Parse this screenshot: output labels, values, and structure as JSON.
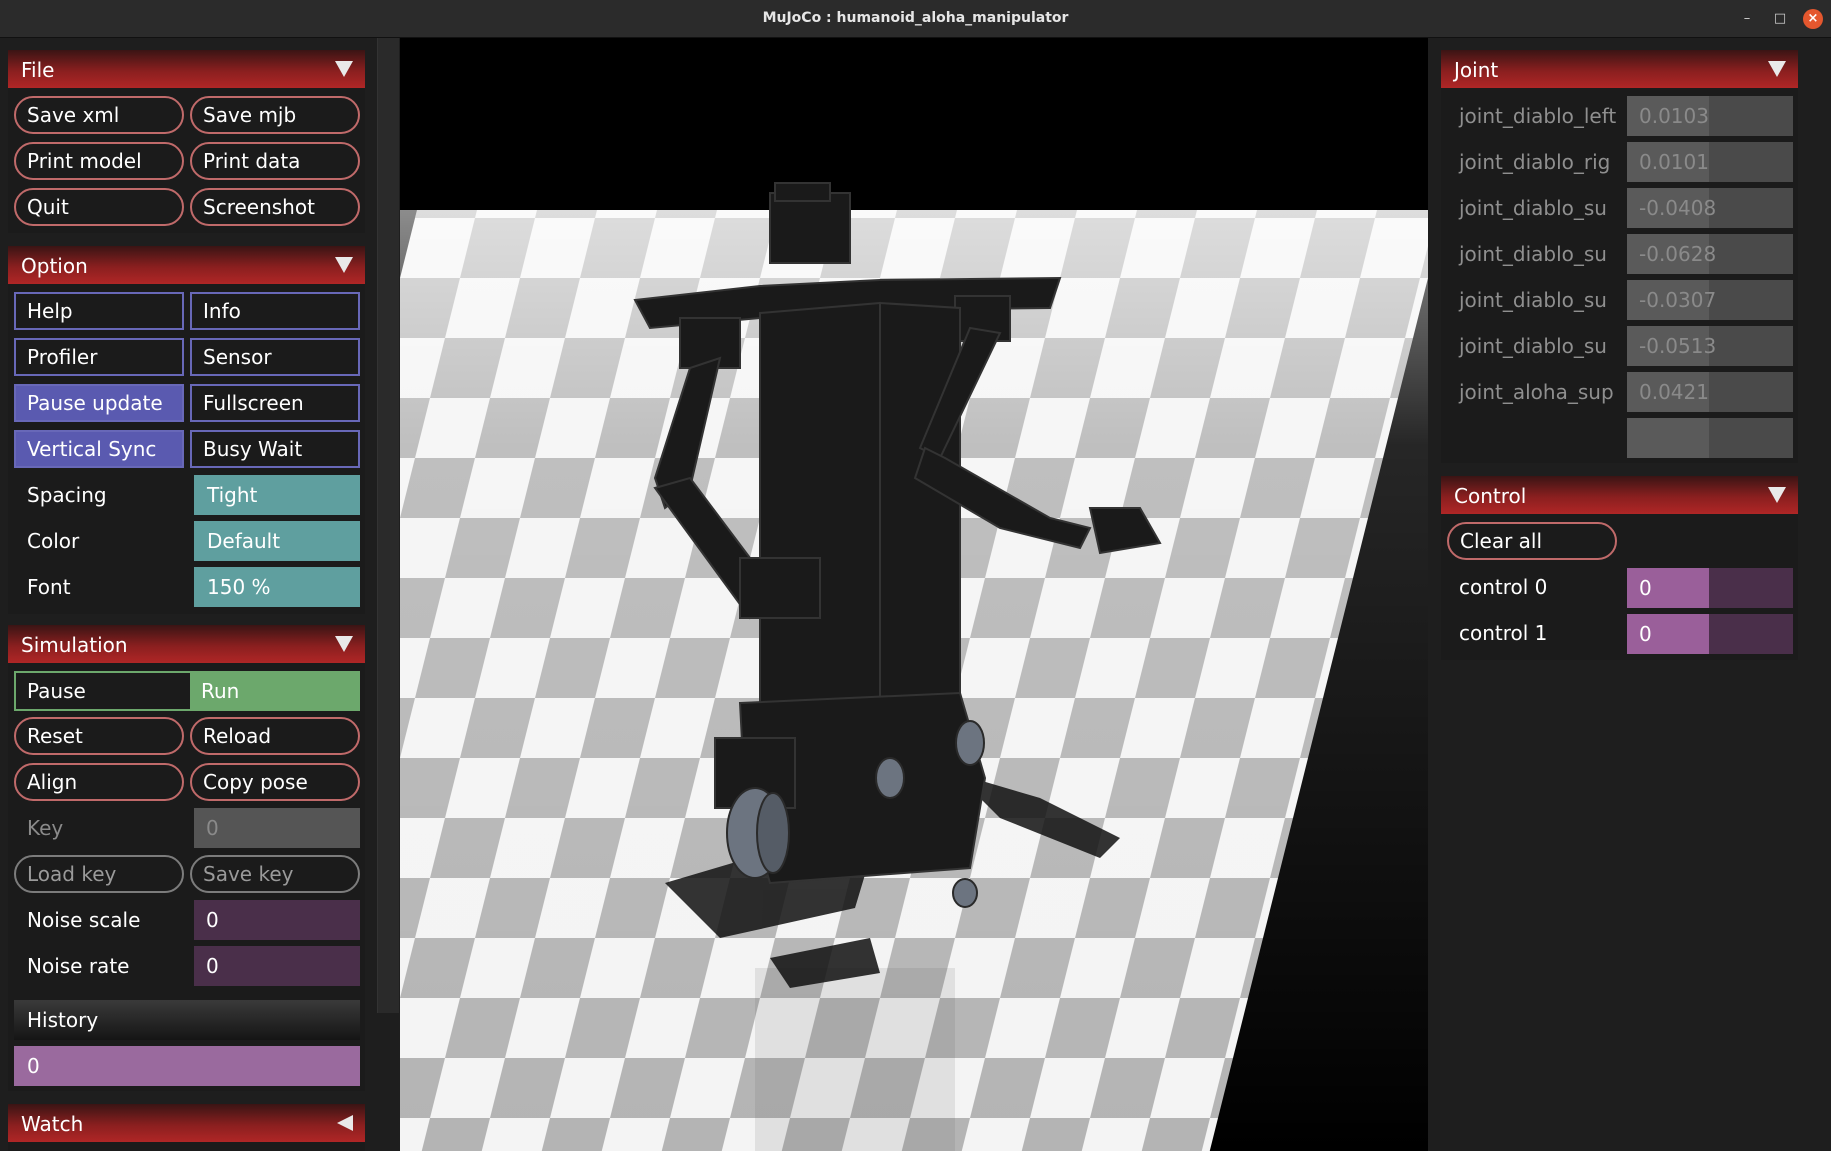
{
  "window": {
    "title": "MuJoCo : humanoid_aloha_manipulator"
  },
  "file": {
    "header": "File",
    "buttons": [
      "Save xml",
      "Save mjb",
      "Print model",
      "Print data",
      "Quit",
      "Screenshot"
    ]
  },
  "option": {
    "header": "Option",
    "toggles": [
      {
        "label": "Help",
        "on": false
      },
      {
        "label": "Info",
        "on": false
      },
      {
        "label": "Profiler",
        "on": false
      },
      {
        "label": "Sensor",
        "on": false
      },
      {
        "label": "Pause update",
        "on": true
      },
      {
        "label": "Fullscreen",
        "on": false
      },
      {
        "label": "Vertical Sync",
        "on": true
      },
      {
        "label": "Busy Wait",
        "on": false
      }
    ],
    "spacing_label": "Spacing",
    "spacing_value": "Tight",
    "color_label": "Color",
    "color_value": "Default",
    "font_label": "Font",
    "font_value": "150 %"
  },
  "simulation": {
    "header": "Simulation",
    "pause": "Pause",
    "run": "Run",
    "reset": "Reset",
    "reload": "Reload",
    "align": "Align",
    "copy_pose": "Copy pose",
    "key_label": "Key",
    "key_value": "0",
    "load_key": "Load key",
    "save_key": "Save key",
    "noise_scale_label": "Noise scale",
    "noise_scale_value": "0",
    "noise_rate_label": "Noise rate",
    "noise_rate_value": "0",
    "history_label": "History",
    "history_value": "0"
  },
  "watch": {
    "header": "Watch"
  },
  "joint": {
    "header": "Joint",
    "rows": [
      {
        "name": "joint_diablo_left",
        "value": "0.0103"
      },
      {
        "name": "joint_diablo_rig",
        "value": "0.0101"
      },
      {
        "name": "joint_diablo_su",
        "value": "-0.0408"
      },
      {
        "name": "joint_diablo_su",
        "value": "-0.0628"
      },
      {
        "name": "joint_diablo_su",
        "value": "-0.0307"
      },
      {
        "name": "joint_diablo_su",
        "value": "-0.0513"
      },
      {
        "name": "joint_aloha_sup",
        "value": "0.0421"
      },
      {
        "name": "",
        "value": ""
      }
    ]
  },
  "control": {
    "header": "Control",
    "clear_all": "Clear all",
    "rows": [
      {
        "name": "control 0",
        "value": "0"
      },
      {
        "name": "control 1",
        "value": "0"
      }
    ]
  }
}
